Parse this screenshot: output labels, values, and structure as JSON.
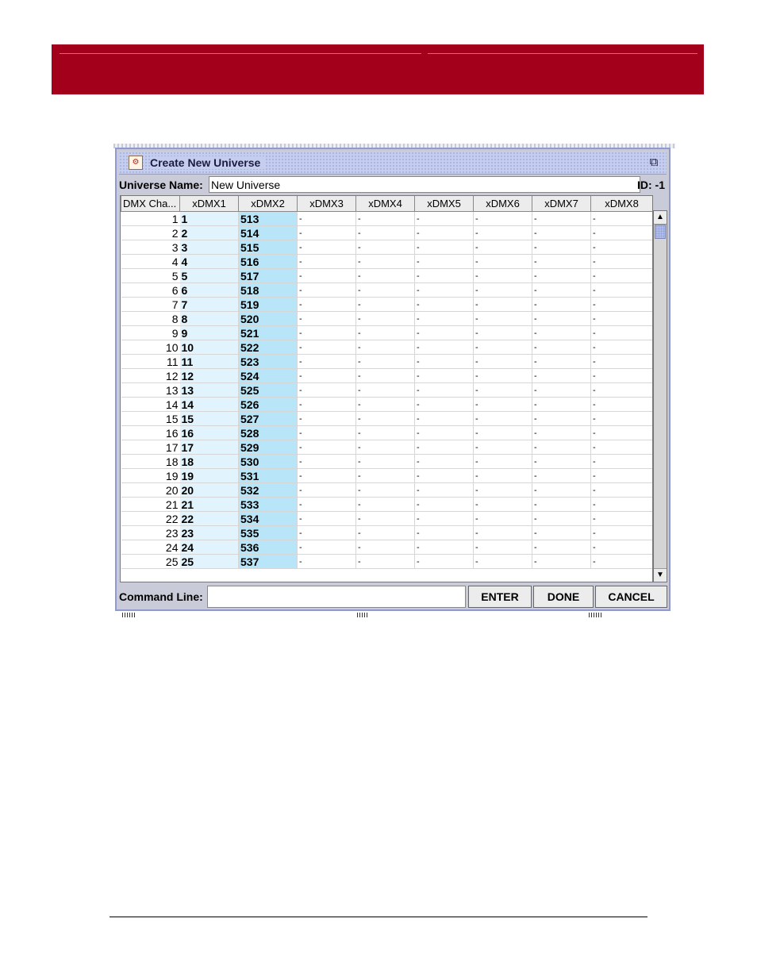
{
  "dialog": {
    "title": "Create New Universe",
    "icon": "universe-wizard-icon",
    "maximize_icon": "maximize-icon"
  },
  "universe": {
    "name_label": "Universe Name:",
    "name_value": "New Universe",
    "id_label": "ID: -1"
  },
  "table": {
    "columns": [
      "DMX Cha...",
      "xDMX1",
      "xDMX2",
      "xDMX3",
      "xDMX4",
      "xDMX5",
      "xDMX6",
      "xDMX7",
      "xDMX8"
    ],
    "empty_marker": "-",
    "rows": [
      {
        "ch": "1",
        "x1": "1",
        "x2": "513"
      },
      {
        "ch": "2",
        "x1": "2",
        "x2": "514"
      },
      {
        "ch": "3",
        "x1": "3",
        "x2": "515"
      },
      {
        "ch": "4",
        "x1": "4",
        "x2": "516"
      },
      {
        "ch": "5",
        "x1": "5",
        "x2": "517"
      },
      {
        "ch": "6",
        "x1": "6",
        "x2": "518"
      },
      {
        "ch": "7",
        "x1": "7",
        "x2": "519"
      },
      {
        "ch": "8",
        "x1": "8",
        "x2": "520"
      },
      {
        "ch": "9",
        "x1": "9",
        "x2": "521"
      },
      {
        "ch": "10",
        "x1": "10",
        "x2": "522"
      },
      {
        "ch": "11",
        "x1": "11",
        "x2": "523"
      },
      {
        "ch": "12",
        "x1": "12",
        "x2": "524"
      },
      {
        "ch": "13",
        "x1": "13",
        "x2": "525"
      },
      {
        "ch": "14",
        "x1": "14",
        "x2": "526"
      },
      {
        "ch": "15",
        "x1": "15",
        "x2": "527"
      },
      {
        "ch": "16",
        "x1": "16",
        "x2": "528"
      },
      {
        "ch": "17",
        "x1": "17",
        "x2": "529"
      },
      {
        "ch": "18",
        "x1": "18",
        "x2": "530"
      },
      {
        "ch": "19",
        "x1": "19",
        "x2": "531"
      },
      {
        "ch": "20",
        "x1": "20",
        "x2": "532"
      },
      {
        "ch": "21",
        "x1": "21",
        "x2": "533"
      },
      {
        "ch": "22",
        "x1": "22",
        "x2": "534"
      },
      {
        "ch": "23",
        "x1": "23",
        "x2": "535"
      },
      {
        "ch": "24",
        "x1": "24",
        "x2": "536"
      },
      {
        "ch": "25",
        "x1": "25",
        "x2": "537"
      }
    ]
  },
  "command": {
    "label": "Command Line:",
    "value": "",
    "enter_label": "ENTER",
    "done_label": "DONE",
    "cancel_label": "CANCEL"
  },
  "colors": {
    "banner": "#a3001c",
    "xdmx1_fill": "#e1f3fc",
    "xdmx2_fill": "#b9e5f8",
    "titlebar": "#c6cef0"
  }
}
